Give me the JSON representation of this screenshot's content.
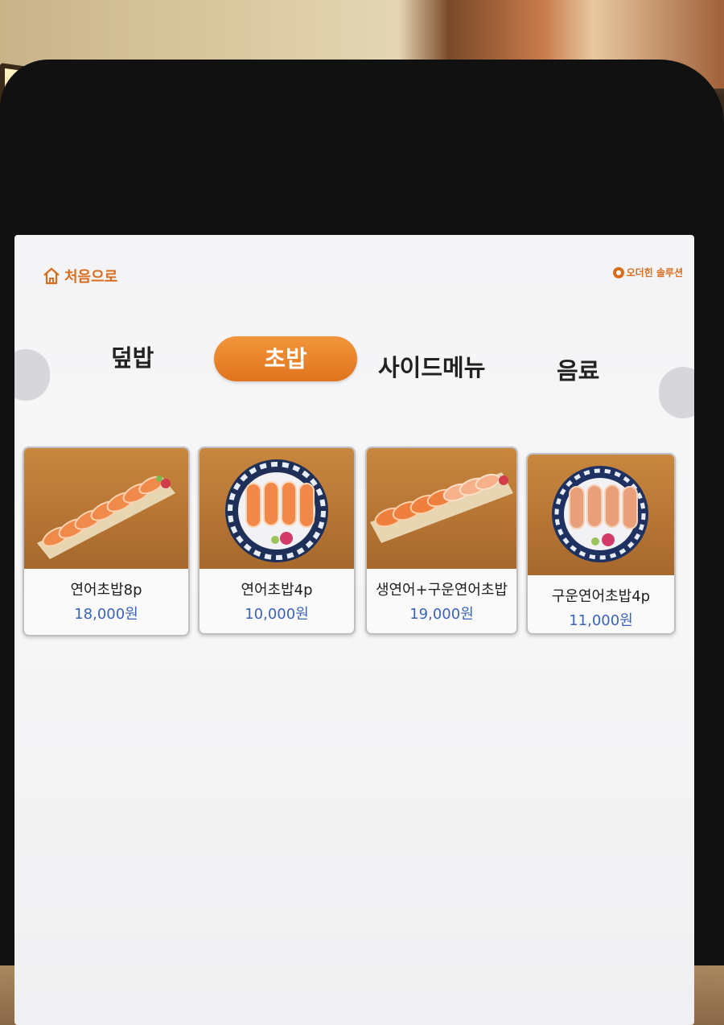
{
  "header": {
    "home_label": "처음으로",
    "brand_label": "오더힌 솔루션"
  },
  "tabs": [
    {
      "label": "덮밥",
      "active": false
    },
    {
      "label": "초밥",
      "active": true
    },
    {
      "label": "사이드메뉴",
      "active": false
    },
    {
      "label": "음료",
      "active": false
    }
  ],
  "menu_items": [
    {
      "name": "연어초밥8p",
      "price": "18,000원",
      "image": "salmon-sushi-board"
    },
    {
      "name": "연어초밥4p",
      "price": "10,000원",
      "image": "salmon-sushi-plate"
    },
    {
      "name": "생연어+구운연어초밥",
      "price": "19,000원",
      "image": "salmon-sushi-board"
    },
    {
      "name": "구운연어초밥4p",
      "price": "11,000원",
      "image": "seared-salmon-plate"
    }
  ],
  "colors": {
    "accent": "#e0731e",
    "price": "#3b63b8"
  }
}
